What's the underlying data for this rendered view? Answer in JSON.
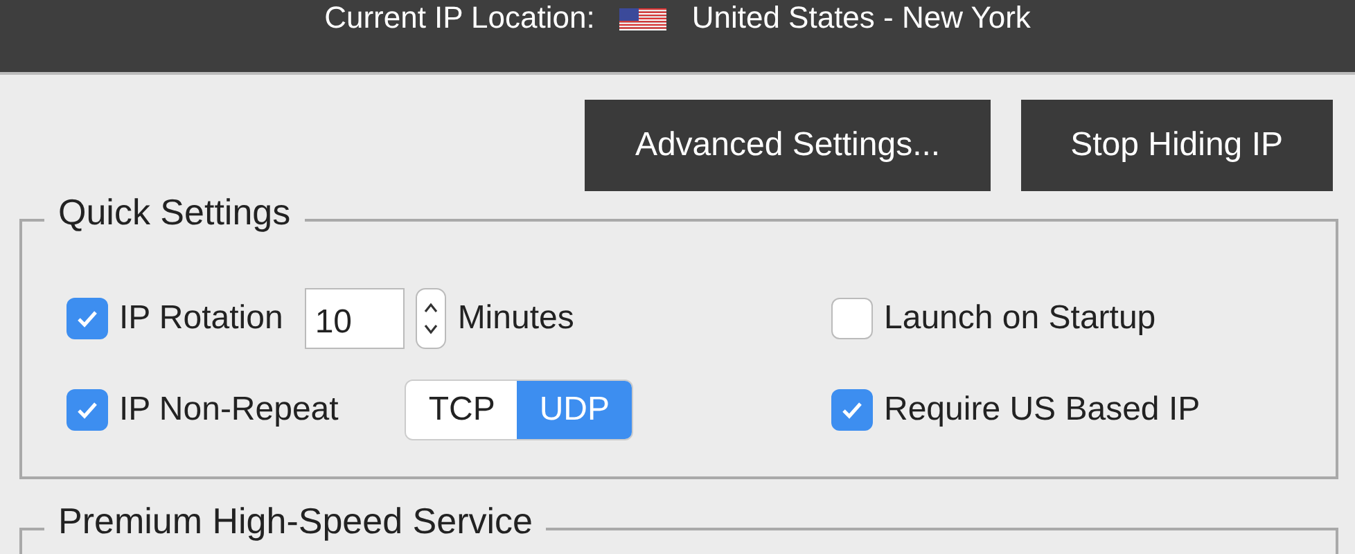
{
  "header": {
    "label": "Current IP Location:",
    "location": "United States - New York"
  },
  "buttons": [
    {
      "label": "Advanced Settings..."
    },
    {
      "label": "Stop Hiding IP"
    }
  ],
  "quick_settings": {
    "title": "Quick Settings",
    "ip_rotation": {
      "label": "IP Rotation",
      "checked": true,
      "value": "10",
      "unit": "Minutes"
    },
    "ip_non_repeat": {
      "label": "IP Non-Repeat",
      "checked": true
    },
    "protocol": [
      {
        "label": "TCP",
        "selected": false
      },
      {
        "label": "UDP",
        "selected": true
      }
    ],
    "launch_on_startup": {
      "label": "Launch on Startup",
      "checked": false
    },
    "require_us_ip": {
      "label": "Require US Based IP",
      "checked": true
    }
  },
  "premium": {
    "title": "Premium High-Speed Service"
  }
}
